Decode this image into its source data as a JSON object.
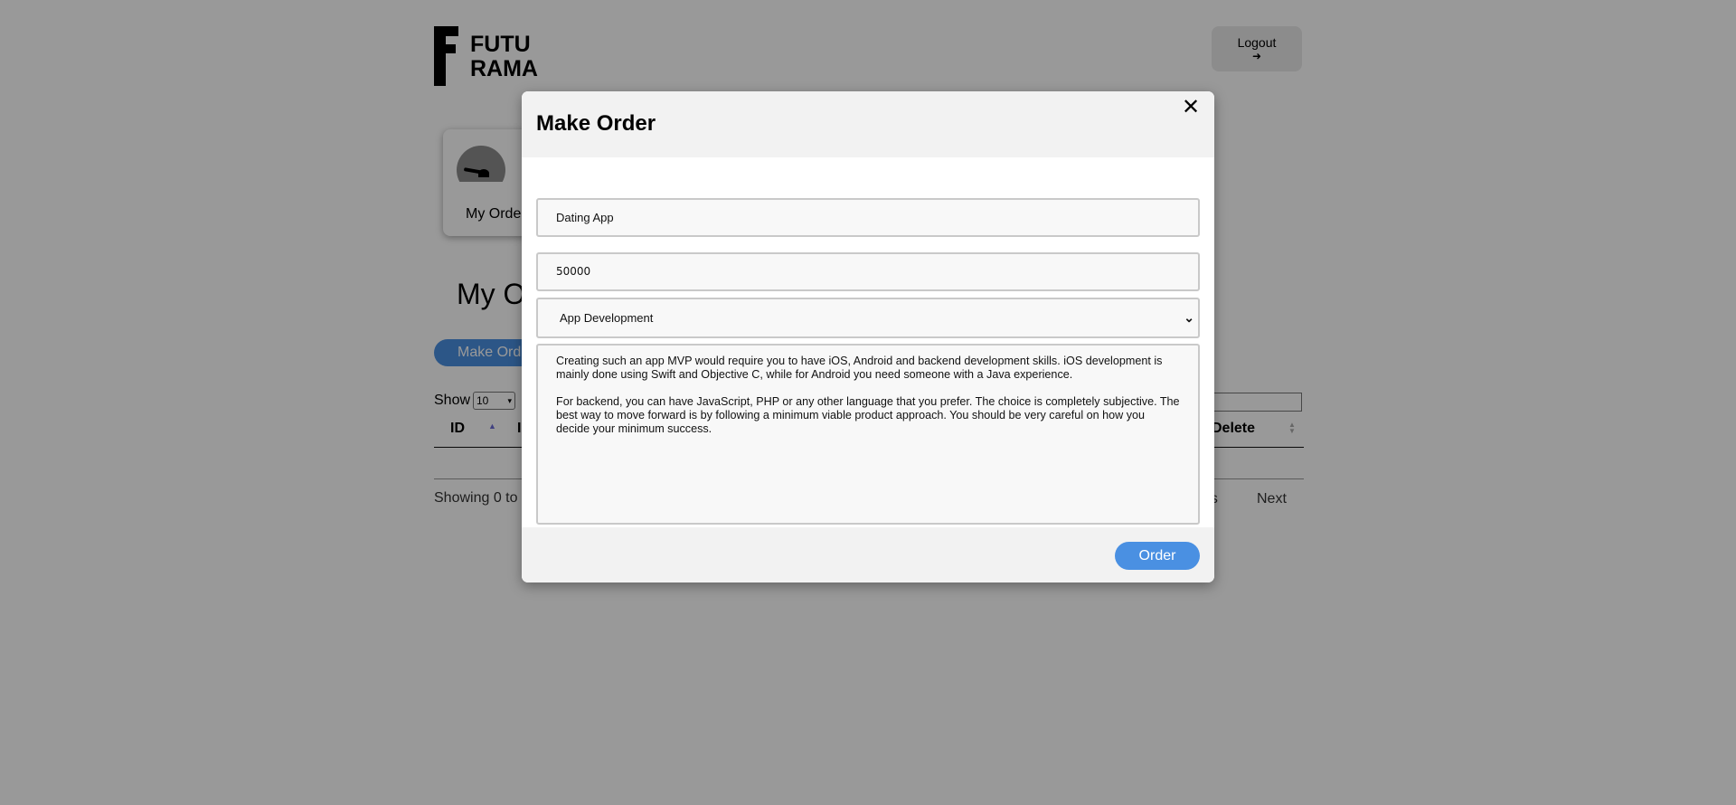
{
  "header": {
    "logo_line1": "FUTU",
    "logo_line2": "RAMA",
    "logout_label": "Logout",
    "logout_icon": "➜"
  },
  "dashboard_card": {
    "label": "My Orde"
  },
  "page": {
    "title": "My O",
    "make_order_label": "Make Ord",
    "show_label": "Show",
    "show_value": "10",
    "table_headers": [
      "ID",
      "I",
      "Delete"
    ],
    "showing_info": "Showing 0 to",
    "prev_label": "us",
    "next_label": "Next"
  },
  "modal": {
    "title": "Make Order",
    "close_icon": "✕",
    "name_value": "Dating App",
    "price_value": "50000",
    "category_value": "App Development",
    "description_value": "Creating such an app MVP would require you to have iOS, Android and backend development skills. iOS development is mainly done using Swift and Objective C, while for Android you need someone with a Java experience.\n\nFor backend, you can have JavaScript, PHP or any other language that you prefer. The choice is completely subjective. The best way to move forward is by following a minimum viable product approach. You should be very careful on how you decide your minimum success.",
    "order_label": "Order"
  },
  "colors": {
    "accent": "#4a90e2",
    "overlay": "rgba(0,0,0,0.4)"
  }
}
